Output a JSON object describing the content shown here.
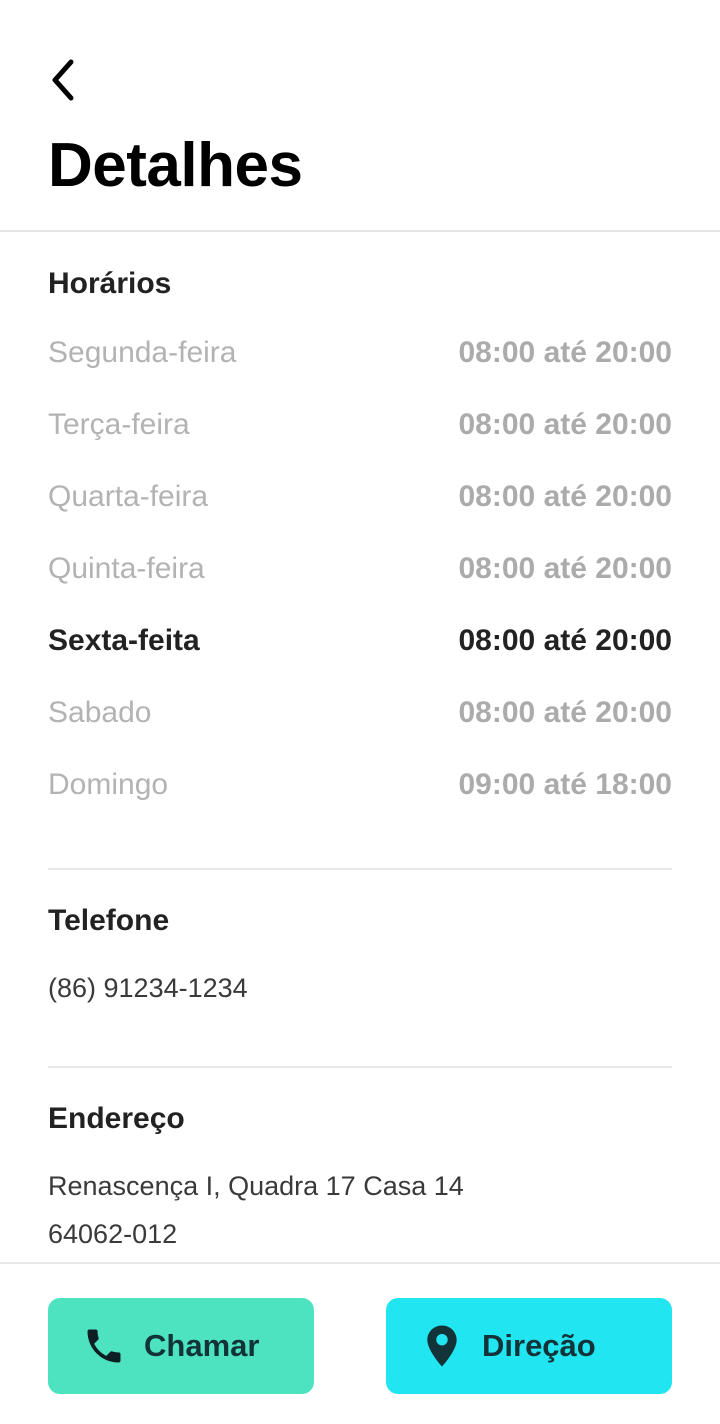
{
  "header": {
    "title": "Detalhes",
    "back_icon": "chevron-left-icon"
  },
  "hours": {
    "title": "Horários",
    "rows": [
      {
        "day": "Segunda-feira",
        "time": "08:00 até 20:00",
        "active": false
      },
      {
        "day": "Terça-feira",
        "time": "08:00 até 20:00",
        "active": false
      },
      {
        "day": "Quarta-feira",
        "time": "08:00 até 20:00",
        "active": false
      },
      {
        "day": "Quinta-feira",
        "time": "08:00 até 20:00",
        "active": false
      },
      {
        "day": "Sexta-feita",
        "time": "08:00 até 20:00",
        "active": true
      },
      {
        "day": "Sabado",
        "time": "08:00 até 20:00",
        "active": false
      },
      {
        "day": "Domingo",
        "time": "09:00 até 18:00",
        "active": false
      }
    ]
  },
  "phone": {
    "title": "Telefone",
    "value": "(86) 91234-1234"
  },
  "address": {
    "title": "Endereço",
    "line1": "Renascença I, Quadra 17 Casa 14",
    "line2": "64062-012"
  },
  "actions": {
    "call_label": "Chamar",
    "call_icon": "phone-icon",
    "directions_label": "Direção",
    "directions_icon": "map-pin-icon"
  },
  "colors": {
    "call_button": "#4ee3c0",
    "directions_button": "#22e5f2",
    "inactive_text": "#b3b3b3",
    "active_text": "#222222"
  }
}
